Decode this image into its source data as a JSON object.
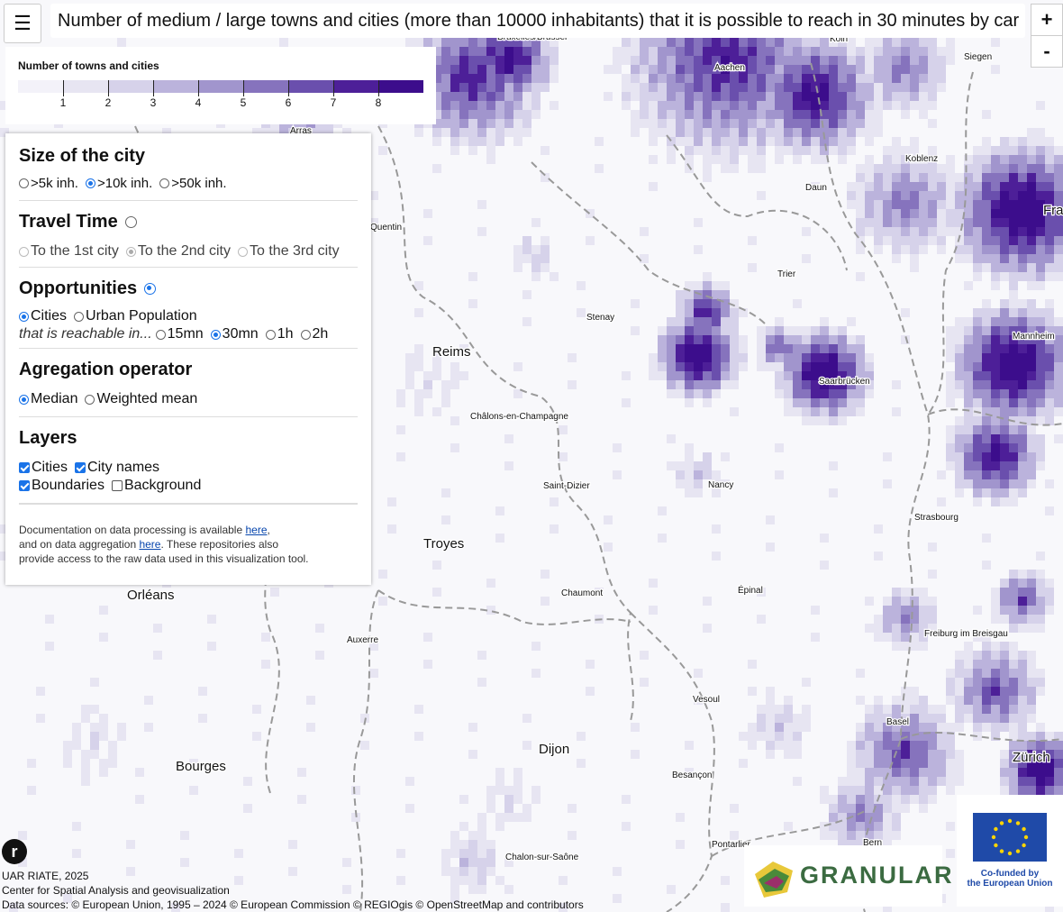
{
  "title": "Number of medium / large towns and cities (more than 10000 inhabitants) that it is possible to reach in 30 minutes by car",
  "menu_icon": "☰",
  "zoom": {
    "in": "+",
    "out": "-"
  },
  "legend": {
    "title": "Number of towns and cities",
    "ticks": [
      "1",
      "2",
      "3",
      "4",
      "5",
      "6",
      "7",
      "8"
    ],
    "colors": [
      "#f3f2f9",
      "#e7e5f2",
      "#d6d2ea",
      "#bbb3dc",
      "#a195cd",
      "#8673bd",
      "#6a4fad",
      "#4d1f98",
      "#3c0d8c"
    ]
  },
  "panel": {
    "size": {
      "heading": "Size of the city",
      "options": [
        ">5k inh.",
        ">10k inh.",
        ">50k inh."
      ],
      "selected": ">10k inh."
    },
    "travel": {
      "heading": "Travel Time",
      "options": [
        "To the 1st city",
        "To the 2nd city",
        "To the 3rd city"
      ],
      "selected": "To the 2nd city"
    },
    "opportunities": {
      "heading": "Opportunities",
      "options": [
        "Cities",
        "Urban Population"
      ],
      "selected": "Cities",
      "reach_label": "that is reachable in...",
      "times": [
        "15mn",
        "30mn",
        "1h",
        "2h"
      ],
      "time_selected": "30mn"
    },
    "aggregation": {
      "heading": "Agregation operator",
      "options": [
        "Median",
        "Weighted mean"
      ],
      "selected": "Median"
    },
    "layers": {
      "heading": "Layers",
      "items": [
        {
          "label": "Cities",
          "checked": true
        },
        {
          "label": "City names",
          "checked": true
        },
        {
          "label": "Boundaries",
          "checked": true
        },
        {
          "label": "Background",
          "checked": false
        }
      ]
    },
    "doc": {
      "t1": "Documentation on data processing is available ",
      "link1": "here",
      "t2": ",",
      "t3": "and on data aggregation ",
      "link2": "here",
      "t4": ". These repositories also",
      "t5": "provide access to the raw data used in this visualization tool."
    }
  },
  "cities_large": [
    "Reims",
    "Troyes",
    "Orléans",
    "Bourges",
    "Dijon",
    "Zürich",
    "Fra"
  ],
  "cities_small": [
    "Aachen",
    "Siegen",
    "Koblenz",
    "Daun",
    "Quentin",
    "Trier",
    "Stenay",
    "Mannheim",
    "Saarbrücken",
    "Châlons-en-Champagne",
    "Saint-Dizier",
    "Nancy",
    "Strasbourg",
    "Chaumont",
    "Épinal",
    "Freiburg im Breisgau",
    "Auxerre",
    "Vesoul",
    "Basel",
    "Besançon",
    "Pontarlier",
    "Bern",
    "Chalon-sur-Saône",
    "Arras",
    "Bruxelles/Brussel",
    "Köln"
  ],
  "footer": {
    "org": "UAR RIATE, 2025",
    "center": "Center for Spatial Analysis and geovisualization",
    "sources": "Data sources: © European Union, 1995 – 2024 © European Commission © REGIOgis © OpenStreetMap and contributors",
    "r_logo": "r"
  },
  "granular": {
    "label": "GRANULAR"
  },
  "eu": {
    "line1": "Co-funded by",
    "line2": "the European Union"
  }
}
